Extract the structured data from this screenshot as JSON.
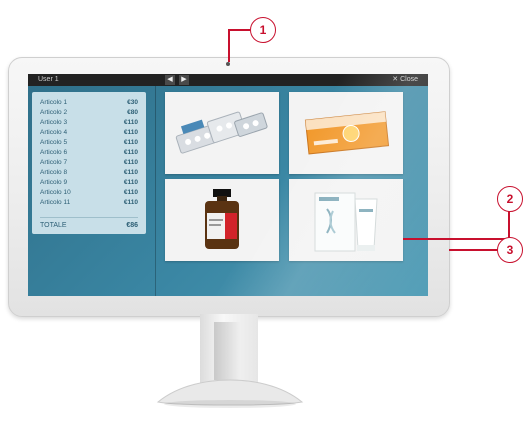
{
  "screen": {
    "top_bar": {
      "user_label": "User 1",
      "prev_icon": "chevron-left-icon",
      "next_icon": "chevron-right-icon",
      "close_label": "Close"
    },
    "receipt": {
      "items": [
        {
          "name": "Articolo 1",
          "price": "€30"
        },
        {
          "name": "Articolo 2",
          "price": "€80"
        },
        {
          "name": "Articolo 3",
          "price": "€110"
        },
        {
          "name": "Articolo 4",
          "price": "€110"
        },
        {
          "name": "Articolo 5",
          "price": "€110"
        },
        {
          "name": "Articolo 6",
          "price": "€110"
        },
        {
          "name": "Articolo 7",
          "price": "€110"
        },
        {
          "name": "Articolo 8",
          "price": "€110"
        },
        {
          "name": "Articolo 9",
          "price": "€110"
        },
        {
          "name": "Articolo 10",
          "price": "€110"
        },
        {
          "name": "Articolo 11",
          "price": "€110"
        }
      ],
      "total_label": "TOTALE",
      "total_value": "€86"
    },
    "products": [
      {
        "icon": "pill-blisters-icon"
      },
      {
        "icon": "medicine-box-icon"
      },
      {
        "icon": "medicine-bottle-icon"
      },
      {
        "icon": "cream-tubes-icon"
      }
    ]
  },
  "callouts": [
    "1",
    "2",
    "3"
  ],
  "colors": {
    "screen_bg": "#3a86a3",
    "receipt_bg": "#c8dfe8",
    "callout": "#c8102e"
  }
}
